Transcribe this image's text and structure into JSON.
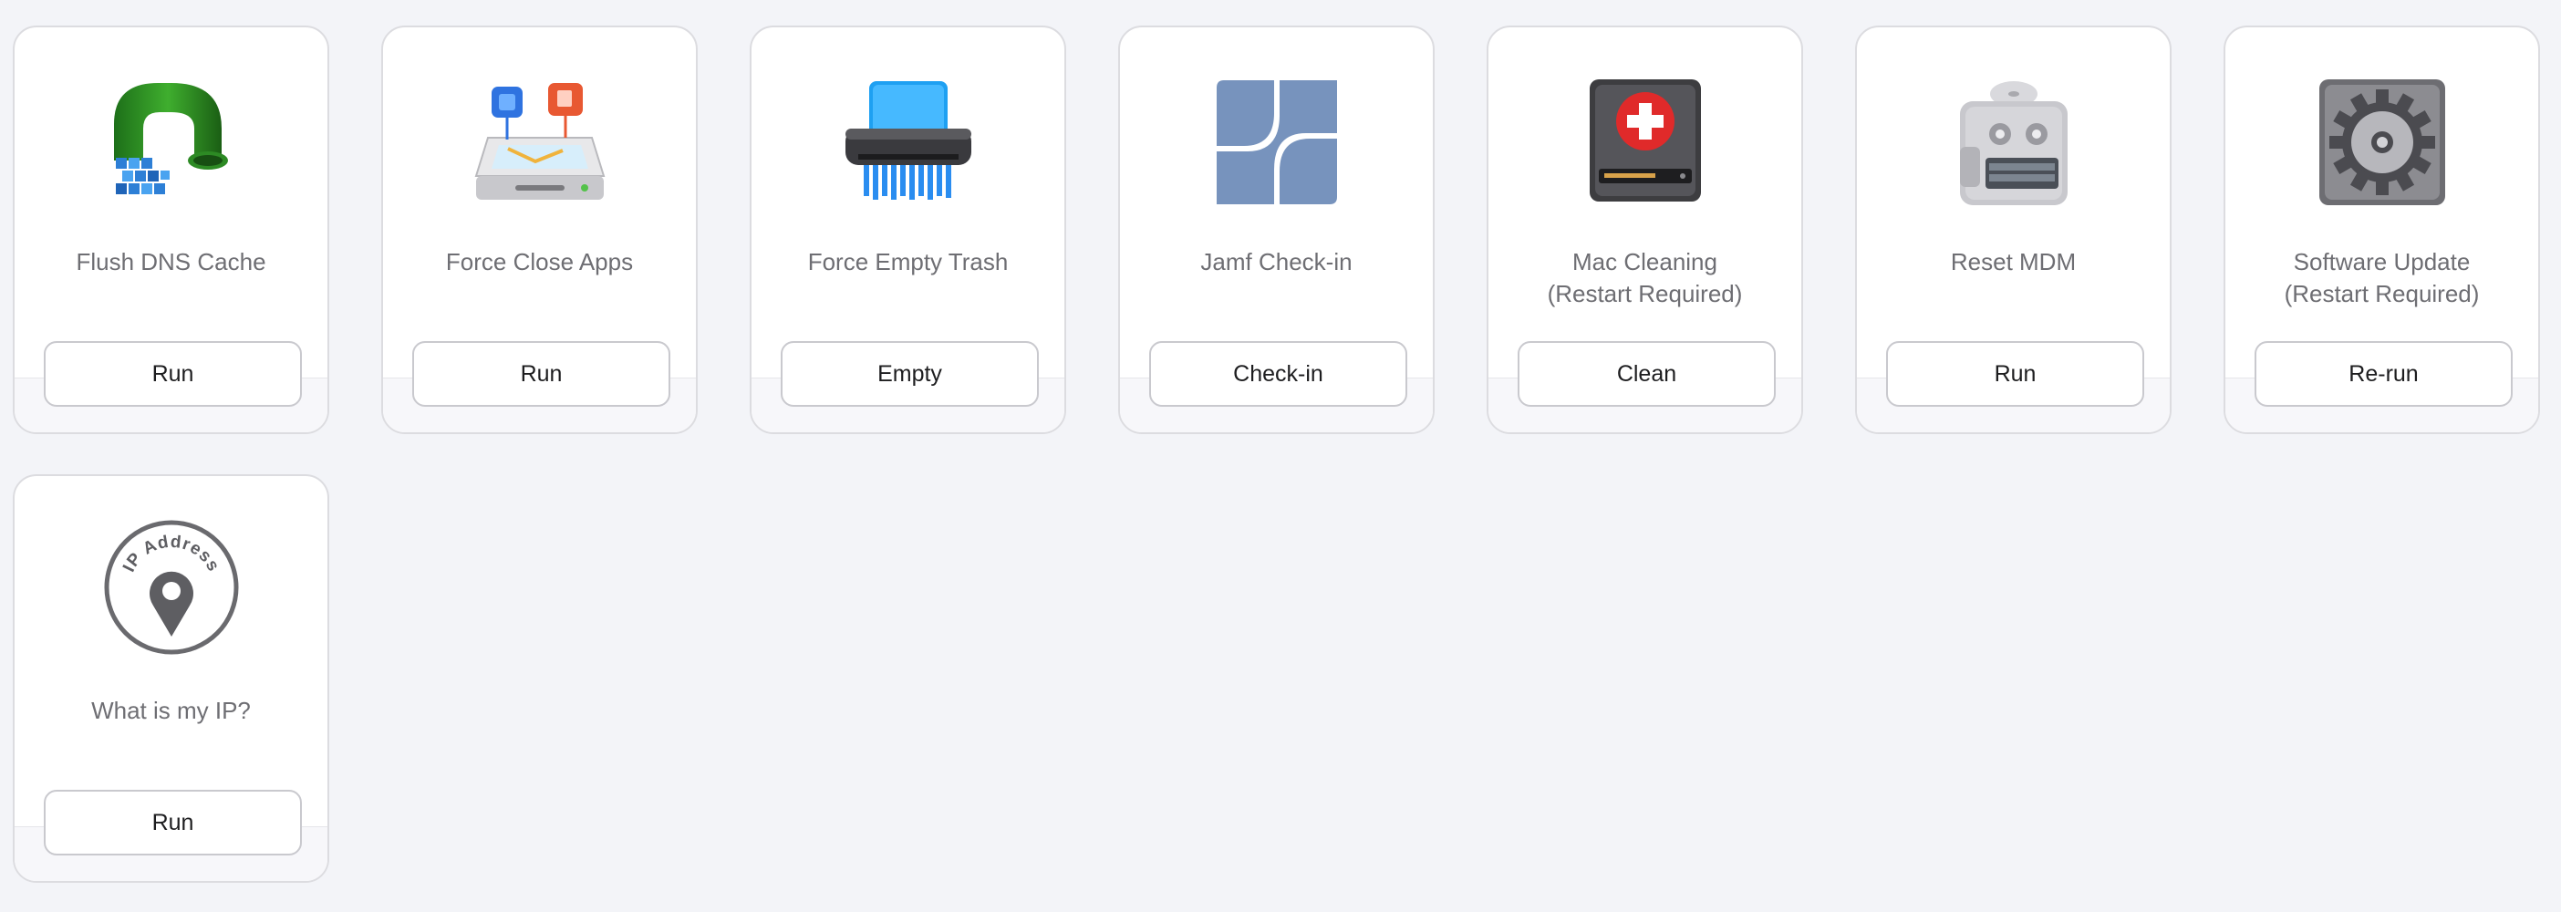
{
  "cards": [
    {
      "title": "Flush DNS Cache",
      "subtitle": "",
      "button": "Run",
      "icon": "pipe-icon"
    },
    {
      "title": "Force Close Apps",
      "subtitle": "",
      "button": "Run",
      "icon": "drive-apps-icon"
    },
    {
      "title": "Force Empty Trash",
      "subtitle": "",
      "button": "Empty",
      "icon": "shredder-icon"
    },
    {
      "title": "Jamf Check-in",
      "subtitle": "",
      "button": "Check-in",
      "icon": "jamf-icon"
    },
    {
      "title": "Mac Cleaning",
      "subtitle": "(Restart Required)",
      "button": "Clean",
      "icon": "drive-first-aid-icon"
    },
    {
      "title": "Reset MDM",
      "subtitle": "",
      "button": "Run",
      "icon": "mdm-device-icon"
    },
    {
      "title": "Software Update",
      "subtitle": "(Restart Required)",
      "button": "Re-run",
      "icon": "gear-icon"
    },
    {
      "title": "What is my IP?",
      "subtitle": "",
      "button": "Run",
      "icon": "ip-address-pin-icon",
      "icon_text": "IP Address"
    }
  ],
  "colors": {
    "background": "#f3f4f8",
    "card": "#ffffff",
    "border": "#dcdce0",
    "title_text": "#6e6e73"
  }
}
